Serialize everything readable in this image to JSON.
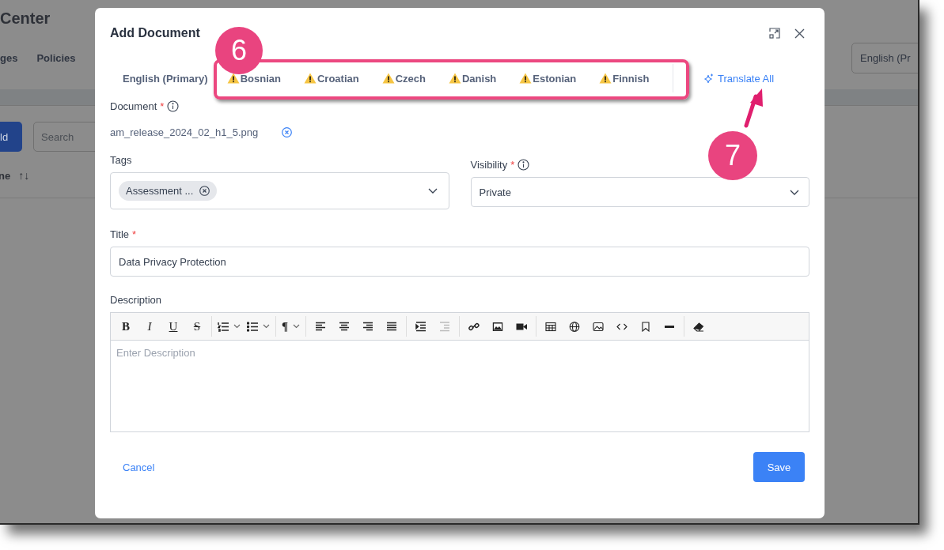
{
  "background": {
    "title": "Center",
    "tabs": [
      "ges",
      "Policies"
    ],
    "add_button": "ld",
    "search": {
      "placeholder": "Search"
    },
    "column_header": "ne",
    "sort_icon": "↑↓",
    "language_select": "English (Pr"
  },
  "dialog": {
    "title": "Add Document",
    "language_tabs": [
      {
        "label": "English (Primary)",
        "warning": false
      },
      {
        "label": "Bosnian",
        "warning": true
      },
      {
        "label": "Croatian",
        "warning": true
      },
      {
        "label": "Czech",
        "warning": true
      },
      {
        "label": "Danish",
        "warning": true
      },
      {
        "label": "Estonian",
        "warning": true
      },
      {
        "label": "Finnish",
        "warning": true
      }
    ],
    "translate_all": "Translate All",
    "document": {
      "label": "Document",
      "required_mark": "*",
      "file": "am_release_2024_02_h1_5.png"
    },
    "tags": {
      "label": "Tags",
      "chips": [
        "Assessment ..."
      ]
    },
    "visibility": {
      "label": "Visibility",
      "required_mark": "*",
      "value": "Private"
    },
    "title_field": {
      "label": "Title",
      "required_mark": "*",
      "value": "Data Privacy Protection"
    },
    "description": {
      "label": "Description",
      "placeholder": "Enter Description",
      "toolbar": [
        [
          {
            "kind": "bold",
            "label": "B"
          },
          {
            "kind": "italic",
            "label": "I"
          },
          {
            "kind": "underline",
            "label": "U"
          },
          {
            "kind": "strike",
            "label": "S"
          }
        ],
        [
          {
            "kind": "ordered-list",
            "dropdown": true
          },
          {
            "kind": "bullet-list",
            "dropdown": true
          }
        ],
        [
          {
            "kind": "paragraph",
            "label": "¶",
            "dropdown": true
          }
        ],
        [
          {
            "kind": "align-left"
          },
          {
            "kind": "align-center"
          },
          {
            "kind": "align-right"
          },
          {
            "kind": "justify"
          }
        ],
        [
          {
            "kind": "indent"
          },
          {
            "kind": "outdent",
            "disabled": true
          }
        ],
        [
          {
            "kind": "link"
          },
          {
            "kind": "image"
          },
          {
            "kind": "video"
          }
        ],
        [
          {
            "kind": "table"
          },
          {
            "kind": "globe"
          },
          {
            "kind": "picture"
          },
          {
            "kind": "code"
          },
          {
            "kind": "bookmark"
          },
          {
            "kind": "rule"
          }
        ],
        [
          {
            "kind": "eraser"
          }
        ]
      ]
    },
    "cancel": "Cancel",
    "save": "Save"
  },
  "annotations": [
    {
      "label": "6"
    },
    {
      "label": "7"
    }
  ]
}
